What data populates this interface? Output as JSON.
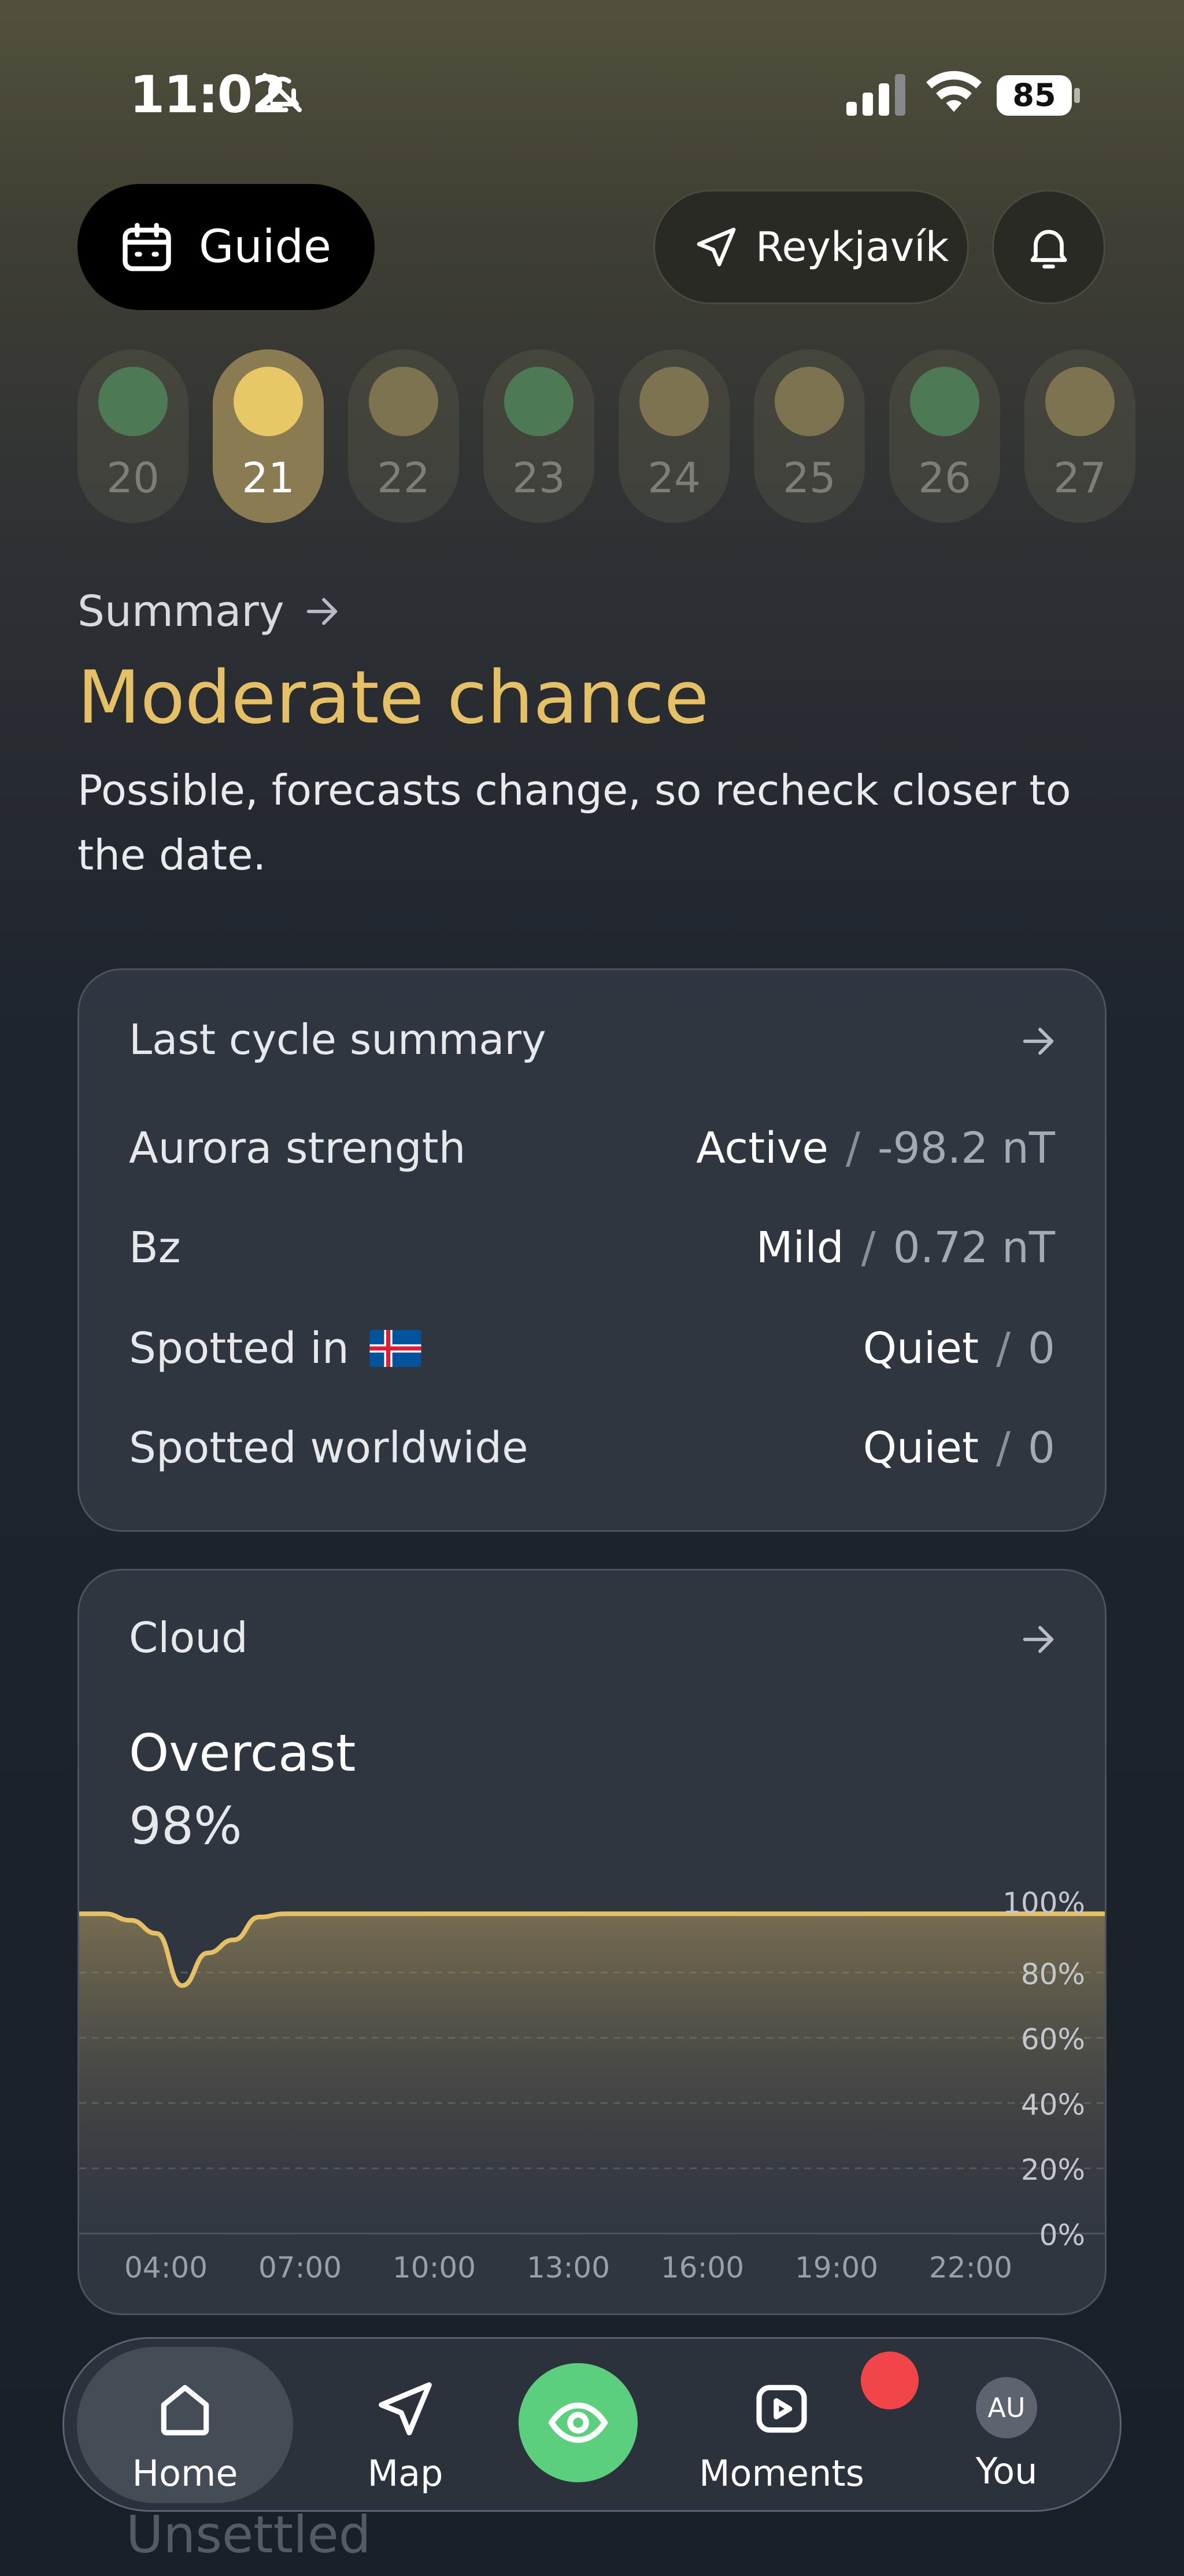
{
  "status_bar": {
    "time": "11:02",
    "battery": "85"
  },
  "header": {
    "guide_label": "Guide",
    "location_label": "Reykjavík"
  },
  "days": [
    {
      "num": "20",
      "color": "#4d7a55"
    },
    {
      "num": "21",
      "color": "#e8c766",
      "selected": true
    },
    {
      "num": "22",
      "color": "#7e7350"
    },
    {
      "num": "23",
      "color": "#4d7a55"
    },
    {
      "num": "24",
      "color": "#7e7350"
    },
    {
      "num": "25",
      "color": "#7e7350"
    },
    {
      "num": "26",
      "color": "#4d7a55"
    },
    {
      "num": "27",
      "color": "#7e7350"
    }
  ],
  "summary": {
    "link": "Summary",
    "headline": "Moderate chance",
    "description": "Possible, forecasts change, so recheck closer to the date."
  },
  "last_cycle": {
    "title": "Last cycle summary",
    "rows": [
      {
        "label": "Aurora strength",
        "status": "Active",
        "value": "-98.2 nT"
      },
      {
        "label": "Bz",
        "status": "Mild",
        "value": "0.72 nT"
      },
      {
        "label": "Spotted in",
        "status": "Quiet",
        "value": "0"
      },
      {
        "label": "Spotted worldwide",
        "status": "Quiet",
        "value": "0"
      }
    ]
  },
  "cloud": {
    "title": "Cloud",
    "status": "Overcast",
    "percent": "98%"
  },
  "chart_data": {
    "type": "area",
    "x": [
      "04:00",
      "04:30",
      "05:00",
      "05:30",
      "06:00",
      "06:30",
      "07:00",
      "07:30",
      "08:00",
      "09:00",
      "10:00",
      "11:00",
      "13:00",
      "16:00",
      "19:00",
      "22:00",
      "24:00"
    ],
    "values": [
      98,
      98,
      96,
      92,
      76,
      86,
      90,
      97,
      98,
      98,
      98,
      98,
      98,
      98,
      98,
      98,
      98
    ],
    "xticks": [
      "04:00",
      "07:00",
      "10:00",
      "13:00",
      "16:00",
      "19:00",
      "22:00"
    ],
    "yticks": [
      "100%",
      "80%",
      "60%",
      "40%",
      "20%",
      "0%"
    ],
    "ylim": [
      0,
      100
    ],
    "line_color": "#e6c065"
  },
  "nav": {
    "home": "Home",
    "map": "Map",
    "moments": "Moments",
    "you": "You",
    "avatar_initials": "AU"
  },
  "below_fold_text": "Unsettled"
}
